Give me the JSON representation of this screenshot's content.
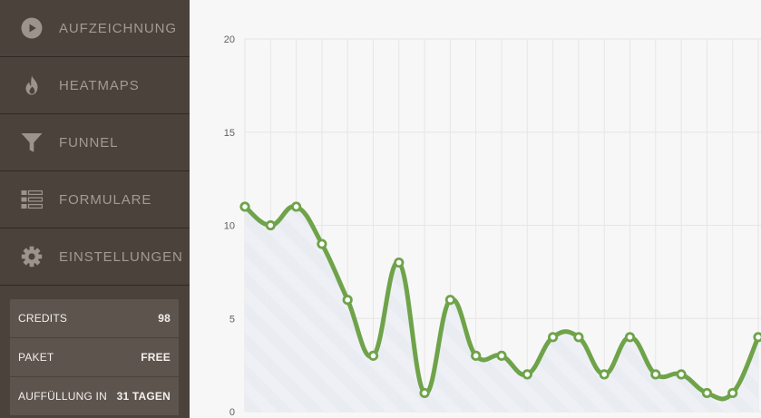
{
  "sidebar": {
    "items": [
      {
        "label": "AUFZEICHNUNG",
        "icon": "play-circle-icon"
      },
      {
        "label": "HEATMAPS",
        "icon": "flame-icon"
      },
      {
        "label": "FUNNEL",
        "icon": "funnel-icon"
      },
      {
        "label": "FORMULARE",
        "icon": "form-list-icon"
      },
      {
        "label": "EINSTELLUNGEN",
        "icon": "gear-icon"
      }
    ]
  },
  "account": {
    "rows": [
      {
        "key": "CREDITS",
        "value": "98"
      },
      {
        "key": "PAKET",
        "value": "FREE"
      },
      {
        "key": "AUFFÜLLUNG IN",
        "value": "31 TAGEN"
      }
    ]
  },
  "colors": {
    "sidebar_bg": "#4b423c",
    "sidebar_text": "#a49a92",
    "info_box_bg": "#5d544d",
    "line": "#6fa34a",
    "area": "#e7eaf0",
    "grid": "#e6e6e6"
  },
  "chart_data": {
    "type": "area",
    "ylim": [
      0,
      20
    ],
    "y_ticks": [
      "0",
      "5",
      "10",
      "15",
      "20"
    ],
    "grid": true,
    "values": [
      11,
      10,
      11,
      9,
      6,
      3,
      8,
      1,
      6,
      3,
      3,
      2,
      4,
      4,
      2,
      4,
      2,
      2,
      1,
      1,
      4
    ]
  }
}
